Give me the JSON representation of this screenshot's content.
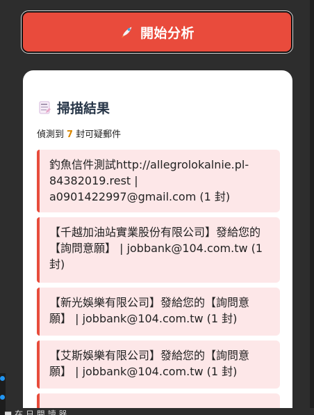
{
  "header": {
    "analyze_button_label": "開始分析",
    "analyze_icon": "rocket-icon"
  },
  "results_card": {
    "title": "掃描結果",
    "title_icon": "note-icon",
    "summary_prefix": "偵測到",
    "count": "7",
    "summary_suffix": "封可疑郵件",
    "items": [
      "釣魚信件測試http://allegrolokalnie.pl-84382019.rest | a0901422997@gmail.com (1 封)",
      "【千越加油站實業股份有限公司】發給您的【詢問意願】 | jobbank@104.com.tw (1 封)",
      "【新光娛樂有限公司】發給您的【詢問意願】 | jobbank@104.com.tw (1 封)",
      "【艾斯娛樂有限公司】發給您的【詢問意願】 | jobbank@104.com.tw (1 封)",
      ""
    ]
  },
  "colors": {
    "background": "#2d2d2d",
    "accent": "#e94b3c",
    "alert_bg": "#fde7e8",
    "count": "#d98700"
  },
  "bottom_bar": {
    "text": "■ 在 日 閱 讀 器"
  }
}
